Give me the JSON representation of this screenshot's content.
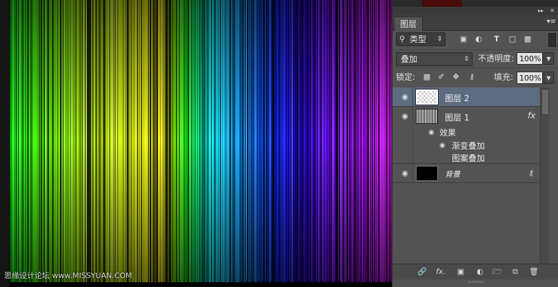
{
  "canvas": {
    "watermark": "思缘设计论坛 www.MISSYUAN.COM"
  },
  "panel": {
    "tab_label": "图层",
    "collapse_icon": "double-chevron-right",
    "close_icon": "close",
    "menu_icon": "panel-menu",
    "filter": {
      "kind_label": "类型",
      "icons": [
        "image-filter-icon",
        "adjustment-filter-icon",
        "type-filter-icon",
        "shape-filter-icon",
        "smart-object-filter-icon"
      ]
    },
    "blend": {
      "mode": "叠加",
      "opacity_label": "不透明度:",
      "opacity_value": "100%"
    },
    "lock": {
      "label": "锁定:",
      "fill_label": "填充:",
      "fill_value": "100%"
    },
    "layers": [
      {
        "name": "图层 2",
        "selected": true
      },
      {
        "name": "图层 1",
        "fx": "fx",
        "effects_label": "效果",
        "effects": [
          "渐变叠加",
          "图案叠加"
        ]
      },
      {
        "name": "背景",
        "locked": true
      }
    ],
    "bottom_icons": [
      "link-layers-icon",
      "fx-icon",
      "mask-icon",
      "adjustment-icon",
      "group-folder-icon",
      "new-layer-icon",
      "trash-icon"
    ],
    "bottom_labels": {
      "fx": "fx."
    }
  }
}
